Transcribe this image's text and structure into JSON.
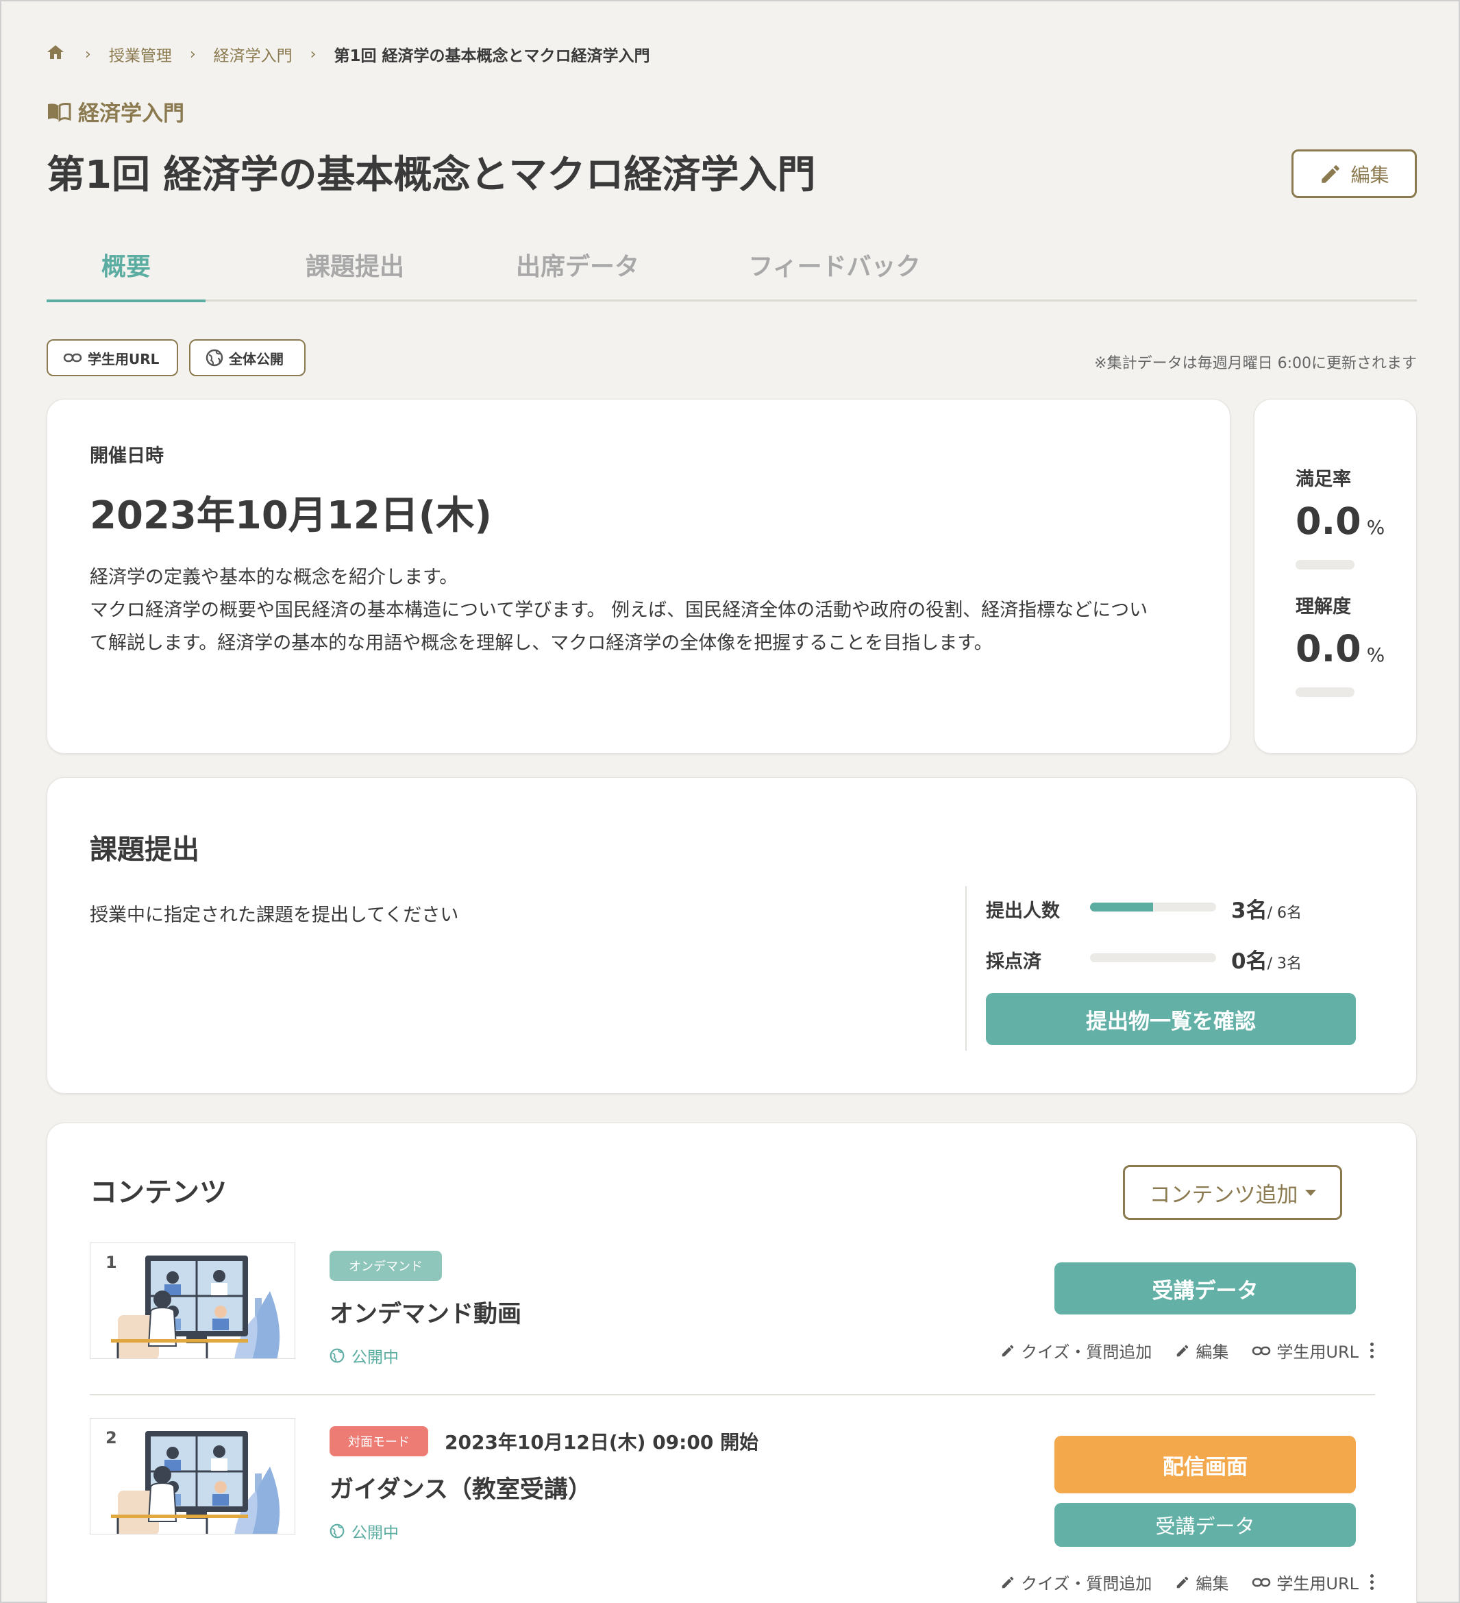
{
  "breadcrumb": {
    "home_icon": "home-icon",
    "items": [
      "授業管理",
      "経済学入門",
      "第1回 経済学の基本概念とマクロ経済学入門"
    ]
  },
  "course": {
    "icon": "book-icon",
    "name": "経済学入門"
  },
  "page_title": "第1回 経済学の基本概念とマクロ経済学入門",
  "edit_label": "編集",
  "tabs": [
    {
      "label": "概要",
      "active": true
    },
    {
      "label": "課題提出",
      "active": false
    },
    {
      "label": "出席データ",
      "active": false
    },
    {
      "label": "フィードバック",
      "active": false
    }
  ],
  "pills": {
    "student_url": "学生用URL",
    "public": "全体公開"
  },
  "update_note": "※集計データは毎週月曜日 6:00に更新されます",
  "overview": {
    "date_label": "開催日時",
    "date_value": "2023年10月12日(木)",
    "description": [
      "経済学の定義や基本的な概念を紹介します。",
      "マクロ経済学の概要や国民経済の基本構造について学びます。 例えば、国民経済全体の活動や政府の役割、経済指標などについ",
      "て解説します。経済学の基本的な用語や概念を理解し、マクロ経済学の全体像を把握することを目指します。"
    ]
  },
  "stats": {
    "satisfaction": {
      "label": "満足率",
      "value": "0.0",
      "unit": "%"
    },
    "understanding": {
      "label": "理解度",
      "value": "0.0",
      "unit": "%"
    }
  },
  "assignment": {
    "title": "課題提出",
    "description": "授業中に指定された課題を提出してください",
    "submitted": {
      "label": "提出人数",
      "value": "3名",
      "of": "/ 6名",
      "fraction": 0.5
    },
    "graded": {
      "label": "採点済",
      "value": "0名",
      "of": "/ 3名",
      "fraction": 0
    },
    "button": "提出物一覧を確認"
  },
  "contents": {
    "title": "コンテンツ",
    "add_label": "コンテンツ追加",
    "items": [
      {
        "number": "1",
        "badge": "オンデマンド",
        "badge_color": "#8fc6bb",
        "title": "オンデマンド動画",
        "status": "公開中",
        "primary_button": "受講データ"
      },
      {
        "number": "2",
        "badge": "対面モード",
        "badge_color": "#ec7c74",
        "start": "2023年10月12日(木) 09:00 開始",
        "title": "ガイダンス（教室受講）",
        "status": "公開中",
        "stream_button": "配信画面",
        "primary_button": "受講データ"
      }
    ],
    "actions": {
      "quiz": "クイズ・質問追加",
      "edit": "編集",
      "url": "学生用URL"
    }
  },
  "colors": {
    "accent": "#5bada2",
    "brand": "#8b7a4f",
    "orange": "#f3a84b"
  }
}
